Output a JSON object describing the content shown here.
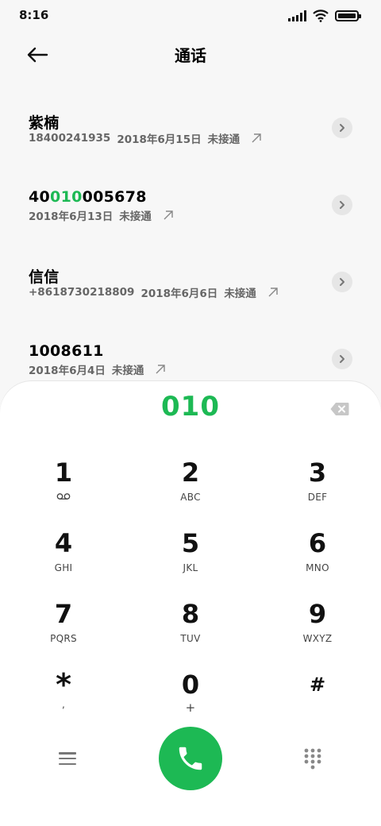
{
  "status_bar": {
    "time": "8:16"
  },
  "header": {
    "title": "通话"
  },
  "calls": [
    {
      "name": "紫楠",
      "name_parts": [
        "紫楠"
      ],
      "number": "18400241935",
      "date": "2018年6月15日",
      "status": "未接通"
    },
    {
      "name": "40010005678",
      "name_parts": [
        "40",
        "010",
        "005678"
      ],
      "number": "",
      "date": "2018年6月13日",
      "status": "未接通"
    },
    {
      "name": "信信",
      "name_parts": [
        "信信"
      ],
      "number": "+8618730218809",
      "date": "2018年6月6日",
      "status": "未接通"
    },
    {
      "name": "1008611",
      "name_parts": [
        "1008611"
      ],
      "number": "",
      "date": "2018年6月4日",
      "status": "未接通"
    }
  ],
  "dialer": {
    "input": "010",
    "keys": [
      {
        "digit": "1",
        "letters": ""
      },
      {
        "digit": "2",
        "letters": "ABC"
      },
      {
        "digit": "3",
        "letters": "DEF"
      },
      {
        "digit": "4",
        "letters": "GHI"
      },
      {
        "digit": "5",
        "letters": "JKL"
      },
      {
        "digit": "6",
        "letters": "MNO"
      },
      {
        "digit": "7",
        "letters": "PQRS"
      },
      {
        "digit": "8",
        "letters": "TUV"
      },
      {
        "digit": "9",
        "letters": "WXYZ"
      },
      {
        "digit": "*",
        "letters": ","
      },
      {
        "digit": "0",
        "letters": "+"
      },
      {
        "digit": "#",
        "letters": ""
      }
    ]
  },
  "icons": {
    "back": "arrow-left-icon",
    "outgoing": "arrow-up-right-icon",
    "detail": "chevron-right-icon",
    "backspace": "backspace-icon",
    "voicemail": "voicemail-icon",
    "menu": "menu-icon",
    "call": "phone-icon",
    "keypad": "dialpad-icon"
  },
  "colors": {
    "accent": "#1db954",
    "background": "#f7f7f7",
    "panel": "#ffffff"
  }
}
